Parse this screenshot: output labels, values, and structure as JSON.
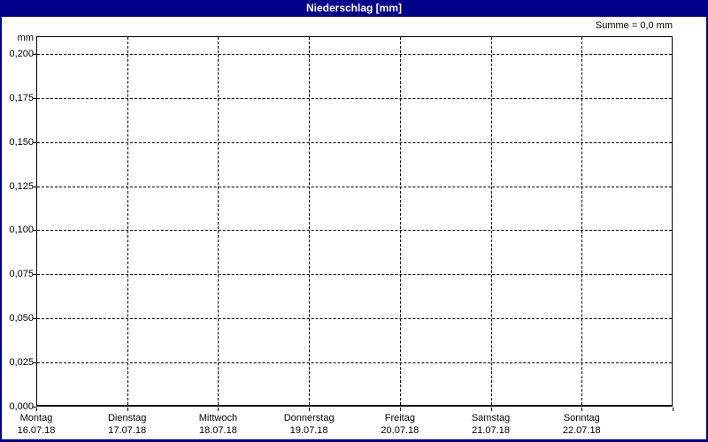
{
  "titlebar": {
    "title": "Niederschlag [mm]"
  },
  "chart_data": {
    "type": "bar",
    "title": "Niederschlag [mm]",
    "subtitle": "",
    "summary": "Summe = 0,0 mm",
    "ylabel": "mm",
    "xlabel": "",
    "ylim": [
      0,
      0.21
    ],
    "grid": "dashed",
    "legend": "none",
    "y_ticks": [
      {
        "label": "0,200",
        "value": 0.2
      },
      {
        "label": "0,175",
        "value": 0.175
      },
      {
        "label": "0,150",
        "value": 0.15
      },
      {
        "label": "0,125",
        "value": 0.125
      },
      {
        "label": "0,100",
        "value": 0.1
      },
      {
        "label": "0,075",
        "value": 0.075
      },
      {
        "label": "0,050",
        "value": 0.05
      },
      {
        "label": "0,025",
        "value": 0.025
      },
      {
        "label": "0,000",
        "value": 0.0
      }
    ],
    "categories": [
      {
        "day": "Montag",
        "date": "16.07.18"
      },
      {
        "day": "Dienstag",
        "date": "17.07.18"
      },
      {
        "day": "Mittwoch",
        "date": "18.07.18"
      },
      {
        "day": "Donnerstag",
        "date": "19.07.18"
      },
      {
        "day": "Freitag",
        "date": "20.07.18"
      },
      {
        "day": "Samstag",
        "date": "21.07.18"
      },
      {
        "day": "Sonntag",
        "date": "22.07.18"
      }
    ],
    "values": [
      0,
      0,
      0,
      0,
      0,
      0,
      0
    ]
  },
  "colors": {
    "titlebar_bg": "#00008B",
    "titlebar_text": "#FFFFFF",
    "window_border": "#00008B",
    "plot_border": "#000000",
    "grid": "#000000",
    "background": "#FFFFFF",
    "text": "#000000",
    "bar": "#0000CC"
  }
}
